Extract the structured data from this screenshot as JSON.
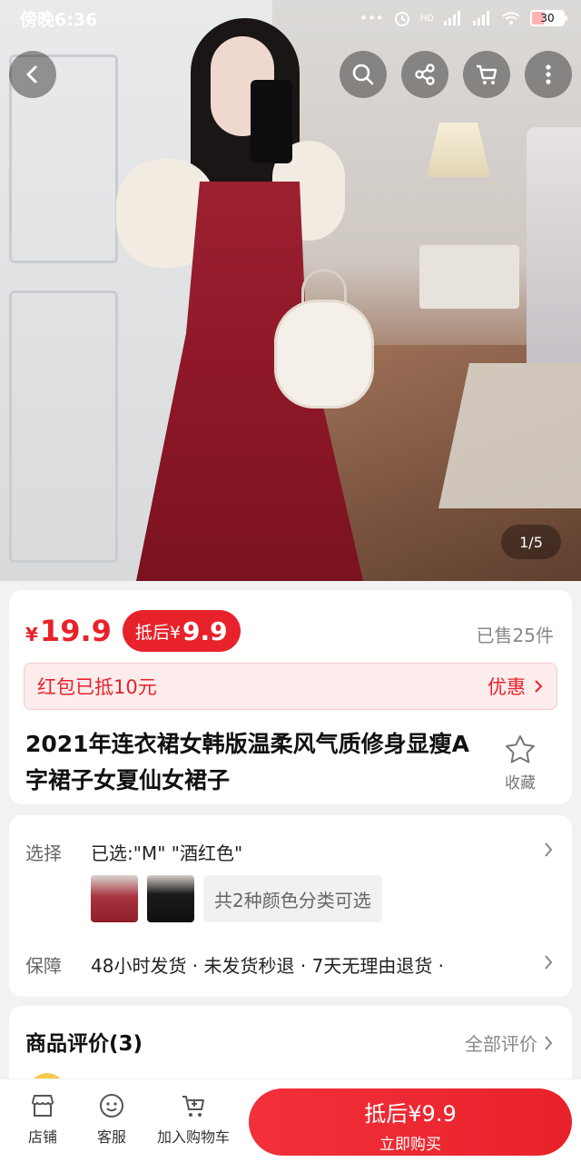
{
  "status_bar": {
    "time": "傍晚6:36",
    "battery": "30",
    "network": "HD"
  },
  "hero": {
    "pager": "1/5"
  },
  "icons": {
    "back": "chevron-left-icon",
    "search": "search-icon",
    "share": "share-icon",
    "cart": "cart-icon",
    "more": "more-icon"
  },
  "price": {
    "currency": "¥",
    "value": "19.9",
    "deal_label": "抵后¥",
    "deal_value": "9.9",
    "sold": "已售25件"
  },
  "coupon": {
    "text": "红包已抵10元",
    "action": "优惠"
  },
  "product": {
    "title": "2021年连衣裙女韩版温柔风气质修身显瘦A字裙子女夏仙女裙子",
    "favorite_label": "收藏"
  },
  "spec": {
    "select_key": "选择",
    "select_value": "已选:\"M\" \"酒红色\"",
    "colors_note": "共2种颜色分类可选",
    "guarantee_key": "保障",
    "guarantee_value": "48小时发货 · 未发货秒退 · 7天无理由退货 ·"
  },
  "reviews": {
    "title": "商品评价(3)",
    "all": "全部评价"
  },
  "bottom_bar": {
    "shop": "店铺",
    "service": "客服",
    "add_cart": "加入购物车",
    "buy_top": "抵后¥9.9",
    "buy_sub": "立即购买"
  },
  "colors": {
    "accent": "#e8222b",
    "coupon_bg": "#fdecec"
  }
}
